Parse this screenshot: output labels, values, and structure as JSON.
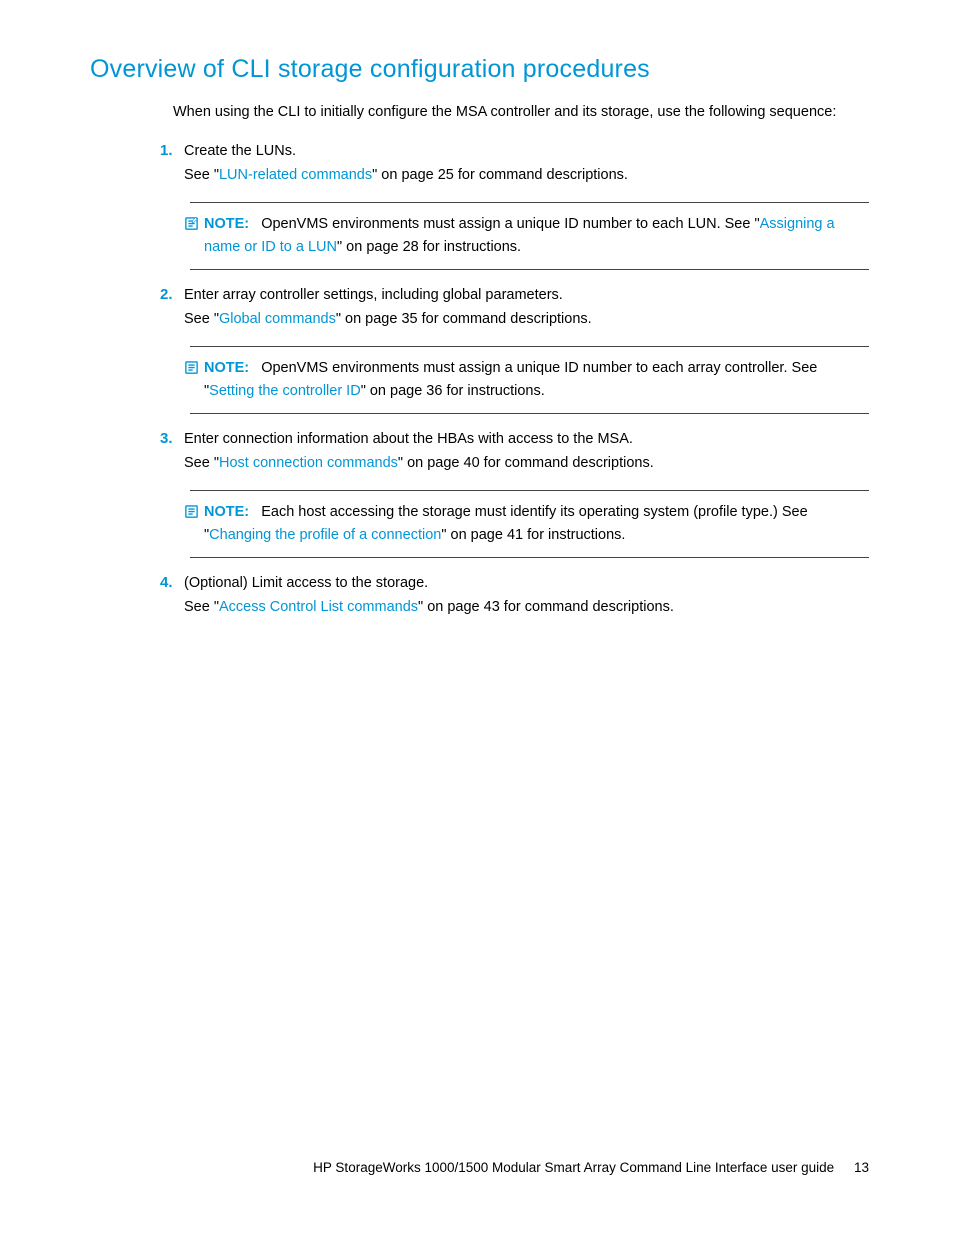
{
  "heading": "Overview of CLI storage configuration procedures",
  "intro": "When using the CLI to initially configure the MSA controller and its storage, use the following sequence:",
  "items": [
    {
      "num": "1.",
      "title": "Create the LUNs.",
      "see_prefix": "See \"",
      "link": "LUN-related commands",
      "see_suffix": "\" on page 25 for command descriptions.",
      "note": {
        "label": "NOTE:",
        "t1": "OpenVMS environments must assign a unique ID number to each LUN. See \"",
        "link": "Assigning a name or ID to a LUN",
        "t2": "\" on page 28 for instructions."
      }
    },
    {
      "num": "2.",
      "title": "Enter array controller settings, including global parameters.",
      "see_prefix": "See \"",
      "link": "Global commands",
      "see_suffix": "\" on page 35 for command descriptions.",
      "note": {
        "label": "NOTE:",
        "t1": "OpenVMS environments must assign a unique ID number to each array controller. See \"",
        "link": "Setting the controller ID",
        "t2": "\" on page 36 for instructions."
      }
    },
    {
      "num": "3.",
      "title": "Enter connection information about the HBAs with access to the MSA.",
      "see_prefix": "See \"",
      "link": "Host connection commands",
      "see_suffix": "\" on page 40 for command descriptions.",
      "note": {
        "label": "NOTE:",
        "t1": "Each host accessing the storage must identify its operating system (profile type.) See \"",
        "link": "Changing the profile of a connection",
        "t2": "\" on page 41 for instructions."
      }
    },
    {
      "num": "4.",
      "title": "(Optional) Limit access to the storage.",
      "see_prefix": "See \"",
      "link": "Access Control List commands",
      "see_suffix": "\" on page 43 for command descriptions."
    }
  ],
  "footer": {
    "text": "HP StorageWorks 1000/1500 Modular Smart Array Command Line Interface user guide",
    "page": "13"
  }
}
